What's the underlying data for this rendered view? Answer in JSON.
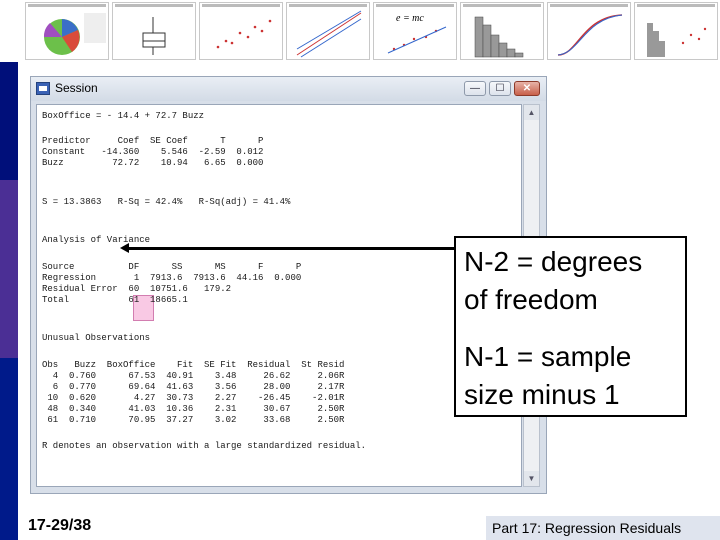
{
  "session_window": {
    "title": "Session",
    "buttons": {
      "minimize": "—",
      "maximize": "☐",
      "close": "✕"
    },
    "output": {
      "lines": [
        "BoxOffice = - 14.4 + 72.7 Buzz",
        "",
        "Predictor     Coef  SE Coef      T      P",
        "Constant   -14.360    5.546  -2.59  0.012",
        "Buzz         72.72    10.94   6.65  0.000",
        "",
        "S = 13.3863   R-Sq = 42.4%   R-Sq(adj) = 41.4%",
        "",
        "Analysis of Variance",
        "",
        "Source          DF      SS      MS      F      P",
        "Regression       1  7913.6  7913.6  44.16  0.000",
        "Residual Error  60  10751.6   179.2",
        "Total           61  18665.1",
        "",
        "Unusual Observations",
        "",
        "Obs   Buzz  BoxOffice    Fit  SE Fit  Residual  St Resid",
        "  4  0.760      67.53  40.91    3.48     26.62     2.06R",
        "  6  0.770      69.64  41.63    3.56     28.00     2.17R",
        " 10  0.620       4.27  30.73    2.27    -26.45    -2.01R",
        " 48  0.340      41.03  10.36    2.31     30.67     2.50R",
        " 61  0.710      70.95  37.27    3.02     33.68     2.50R",
        "",
        "R denotes an observation with a large standardized residual."
      ]
    }
  },
  "callout": {
    "line1a": "N-2 = degrees",
    "line1b": "of freedom",
    "line2a": "N-1 = sample",
    "line2b": "size minus 1"
  },
  "footer": {
    "slide_number": "17-29/38",
    "section": "Part 17: Regression Residuals"
  },
  "thumbnails": {
    "equation_text": "e = mc"
  },
  "colors": {
    "left_bar_top": "#000f7a",
    "left_bar_mid": "#4b2f95",
    "highlight": "#f9c9e4"
  }
}
